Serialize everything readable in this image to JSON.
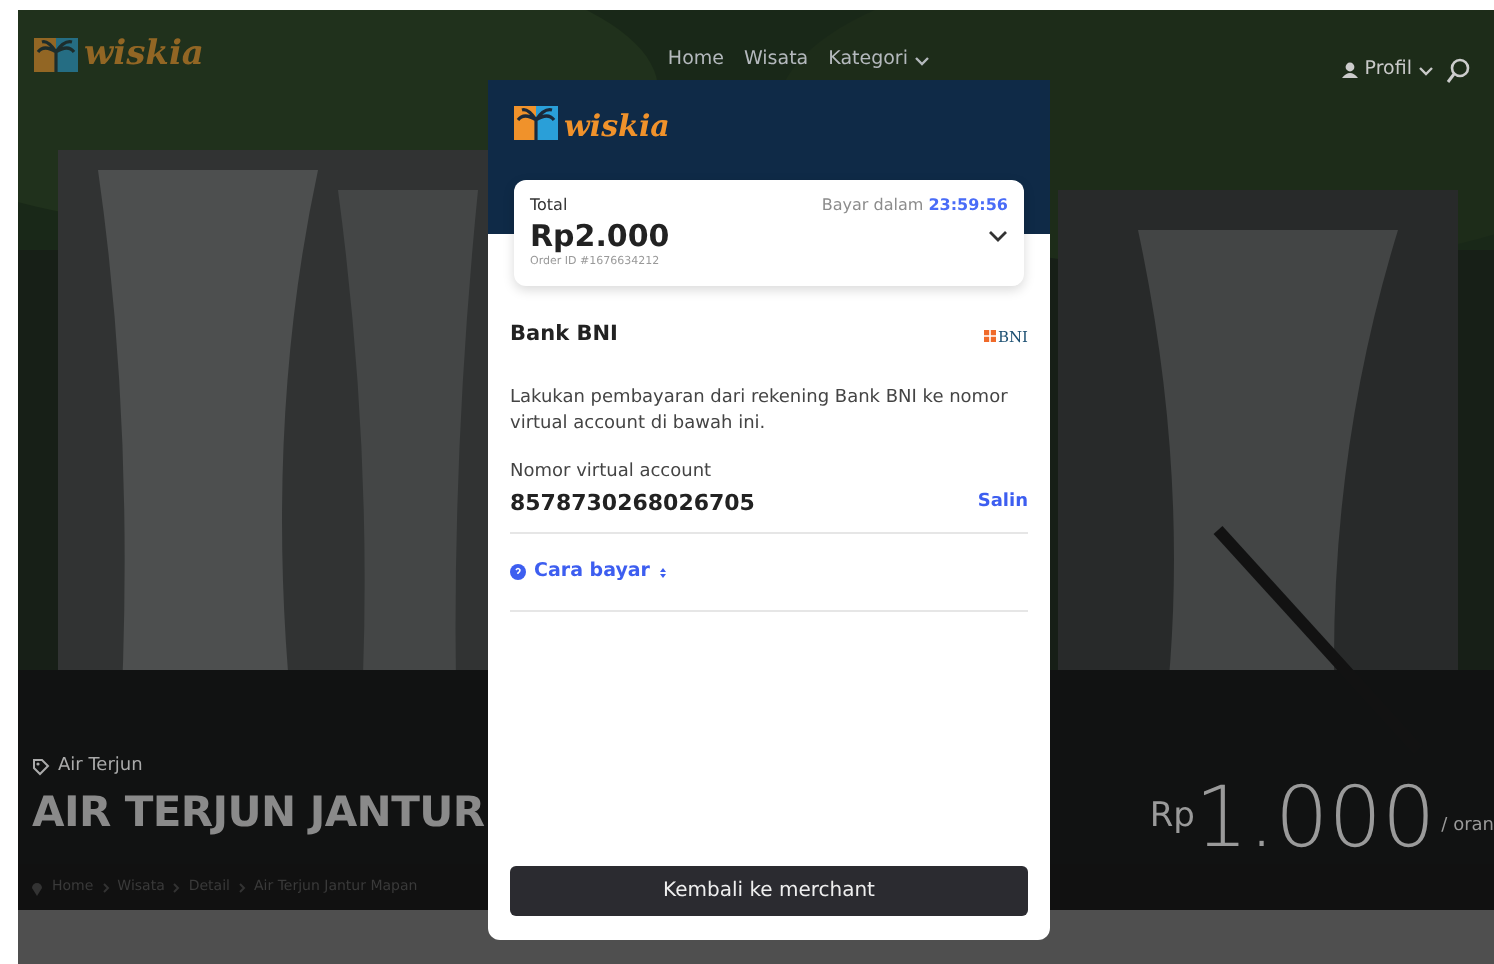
{
  "navbar": {
    "logo": "wiskia",
    "links": [
      {
        "label": "Home",
        "dropdown": false
      },
      {
        "label": "Wisata",
        "dropdown": false
      },
      {
        "label": "Kategori",
        "dropdown": true
      }
    ],
    "profile": "Profil"
  },
  "hero": {
    "category": "Air Terjun",
    "title": "AIR TERJUN JANTUR",
    "currency": "Rp",
    "price": "1.000",
    "unit": "/ oran"
  },
  "breadcrumb": [
    "Home",
    "Wisata",
    "Detail",
    "Air Terjun Jantur Mapan"
  ],
  "payment": {
    "logo": "wiskia",
    "total_label": "Total",
    "amount": "Rp2.000",
    "order_id": "Order ID #1676634212",
    "deadline_label": "Bayar dalam",
    "countdown": "23:59:56",
    "bank_name": "Bank BNI",
    "bank_logo": "BNI",
    "instruction": "Lakukan pembayaran dari rekening Bank BNI ke nomor virtual account di bawah ini.",
    "va_label": "Nomor virtual account",
    "va_number": "8578730268026705",
    "copy": "Salin",
    "howto": "Cara bayar",
    "button": "Kembali ke merchant"
  }
}
